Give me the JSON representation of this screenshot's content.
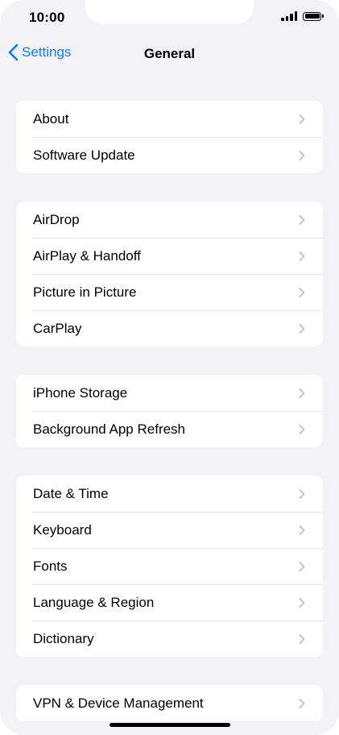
{
  "status_bar": {
    "time": "10:00",
    "icons": [
      "signal-icon",
      "battery-icon"
    ]
  },
  "nav": {
    "back_label": "Settings",
    "title": "General",
    "back_icon": "chevron-left-icon"
  },
  "colors": {
    "accent": "#0a7aff",
    "background": "#f2f2f7",
    "cell": "#ffffff",
    "separator": "#e5e5ea",
    "chevron": "#c4c4c7"
  },
  "groups": [
    {
      "items": [
        {
          "label": "About"
        },
        {
          "label": "Software Update"
        }
      ]
    },
    {
      "items": [
        {
          "label": "AirDrop"
        },
        {
          "label": "AirPlay & Handoff"
        },
        {
          "label": "Picture in Picture"
        },
        {
          "label": "CarPlay"
        }
      ]
    },
    {
      "items": [
        {
          "label": "iPhone Storage"
        },
        {
          "label": "Background App Refresh"
        }
      ]
    },
    {
      "items": [
        {
          "label": "Date & Time"
        },
        {
          "label": "Keyboard"
        },
        {
          "label": "Fonts"
        },
        {
          "label": "Language & Region"
        },
        {
          "label": "Dictionary"
        }
      ]
    },
    {
      "items": [
        {
          "label": "VPN & Device Management"
        }
      ]
    }
  ]
}
